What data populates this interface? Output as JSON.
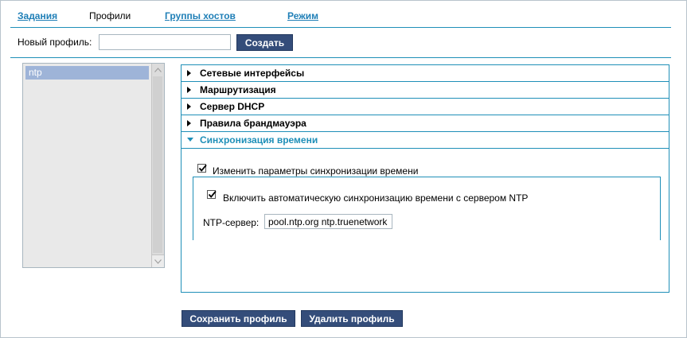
{
  "tabs": [
    {
      "label": "Задания",
      "active": false
    },
    {
      "label": "Профили",
      "active": true
    },
    {
      "label": "Группы хостов",
      "active": false
    },
    {
      "label": "Режим",
      "active": false
    }
  ],
  "new_profile": {
    "label": "Новый профиль:",
    "value": "",
    "create_label": "Создать"
  },
  "profiles": {
    "items": [
      "ntp"
    ],
    "selected": "ntp"
  },
  "sections": [
    {
      "label": "Сетевые интерфейсы",
      "expanded": false
    },
    {
      "label": "Маршрутизация",
      "expanded": false
    },
    {
      "label": "Сервер DHCP",
      "expanded": false
    },
    {
      "label": "Правила брандмауэра",
      "expanded": false
    },
    {
      "label": "Синхронизация времени",
      "expanded": true
    }
  ],
  "time_sync": {
    "change_params_label": "Изменить параметры синхронизации времени",
    "change_params_checked": true,
    "auto_sync_label": "Включить автоматическую синхронизацию времени с сервером NTP",
    "auto_sync_checked": true,
    "ntp_server_label": "NTP-сервер:",
    "ntp_server_value": "pool.ntp.org ntp.truenetwork"
  },
  "actions": {
    "save_label": "Сохранить профиль",
    "delete_label": "Удалить профиль"
  },
  "colors": {
    "accent": "#1f8fb8",
    "link": "#1f7fb7",
    "button": "#344d7a",
    "selection": "#9eb4d8"
  },
  "icons": {
    "collapsed": "triangle-right-icon",
    "expanded": "triangle-down-icon",
    "checkbox": "checkmark-icon"
  }
}
